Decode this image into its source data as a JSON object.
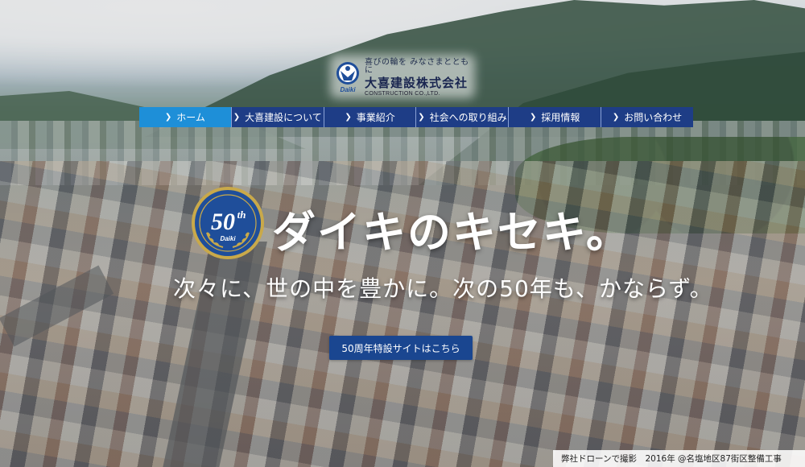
{
  "logo": {
    "tagline": "喜びの輪を みなさまとともに",
    "company_name": "大喜建設株式会社",
    "english_name": "CONSTRUCTION CO.,LTD.",
    "mark_text": "Daiki"
  },
  "nav": {
    "items": [
      {
        "label": "ホーム",
        "active": true
      },
      {
        "label": "大喜建設について",
        "active": false
      },
      {
        "label": "事業紹介",
        "active": false
      },
      {
        "label": "社会への取り組み",
        "active": false
      },
      {
        "label": "採用情報",
        "active": false
      },
      {
        "label": "お問い合わせ",
        "active": false
      }
    ],
    "arrow_icon": "chevron-right-icon"
  },
  "hero": {
    "badge_number": "50",
    "badge_suffix": "th",
    "badge_brand": "Daiki",
    "title": "ダイキのキセキ。",
    "subtitle": "次々に、世の中を豊かに。次の50年も、かならず。",
    "cta_label": "50周年特設サイトはこちら"
  },
  "caption": {
    "text": "弊社ドローンで撮影　2016年 @名塩地区87街区整備工事"
  },
  "colors": {
    "nav_bg": "#1e3d86",
    "nav_active_bg": "#1e8fd8",
    "cta_bg": "#1a4690",
    "badge_blue": "#1f4e9a",
    "badge_gold": "#c9a94a"
  }
}
